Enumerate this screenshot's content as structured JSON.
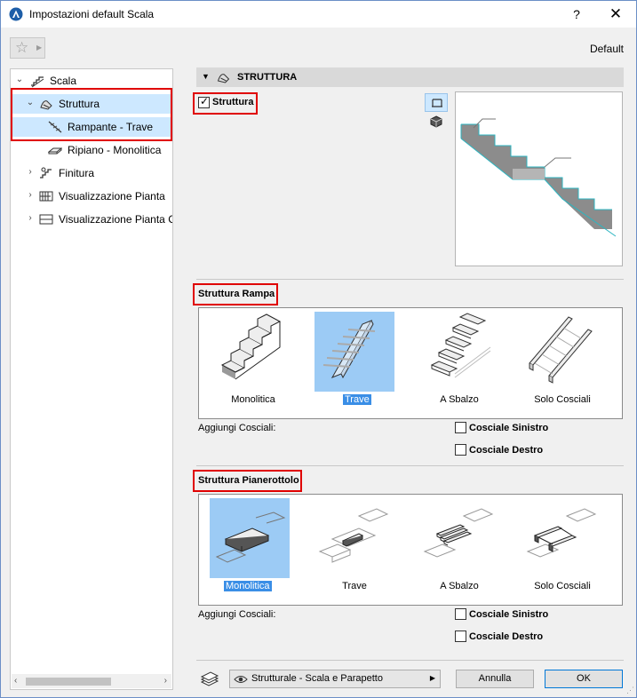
{
  "window": {
    "title": "Impostazioni default Scala",
    "help_label": "?",
    "close_label": "✕",
    "favorites_star": "☆",
    "default_label": "Default"
  },
  "tree": {
    "items": [
      {
        "label": "Scala",
        "icon": "stair-icon"
      },
      {
        "label": "Struttura",
        "icon": "structure-icon"
      },
      {
        "label": "Rampante - Trave",
        "icon": "beam-flight-icon"
      },
      {
        "label": "Ripiano - Monolitica",
        "icon": "monolithic-landing-icon"
      },
      {
        "label": "Finitura",
        "icon": "finish-icon"
      },
      {
        "label": "Visualizzazione Pianta",
        "icon": "floor-plan-icon"
      },
      {
        "label": "Visualizzazione Pianta Co",
        "icon": "floor-plan-cover-icon"
      }
    ]
  },
  "panel": {
    "header": "STRUTTURA",
    "structure_checkbox": {
      "label": "Struttura",
      "checked": true
    },
    "flight_section": {
      "title": "Struttura Rampa",
      "options": [
        "Monolitica",
        "Trave",
        "A Sbalzo",
        "Solo Cosciali"
      ],
      "selected": "Trave",
      "add_stringers_label": "Aggiungi Cosciali:",
      "left_stringer": {
        "label": "Cosciale Sinistro",
        "checked": false
      },
      "right_stringer": {
        "label": "Cosciale Destro",
        "checked": false
      }
    },
    "landing_section": {
      "title": "Struttura Pianerottolo",
      "options": [
        "Monolitica",
        "Trave",
        "A Sbalzo",
        "Solo Cosciali"
      ],
      "selected": "Monolitica",
      "add_stringers_label": "Aggiungi Cosciali:",
      "left_stringer": {
        "label": "Cosciale Sinistro",
        "checked": false
      },
      "right_stringer": {
        "label": "Cosciale Destro",
        "checked": false
      }
    }
  },
  "footer": {
    "layer_dropdown": "Strutturale - Scala e Parapetto",
    "cancel_label": "Annulla",
    "ok_label": "OK"
  },
  "colors": {
    "accent": "#3a8ee6",
    "selection": "#9ccbf5",
    "highlight_border": "#e00000",
    "preview_stair_fill": "#8c8c8c",
    "preview_stair_edge": "#2cb5c0"
  }
}
